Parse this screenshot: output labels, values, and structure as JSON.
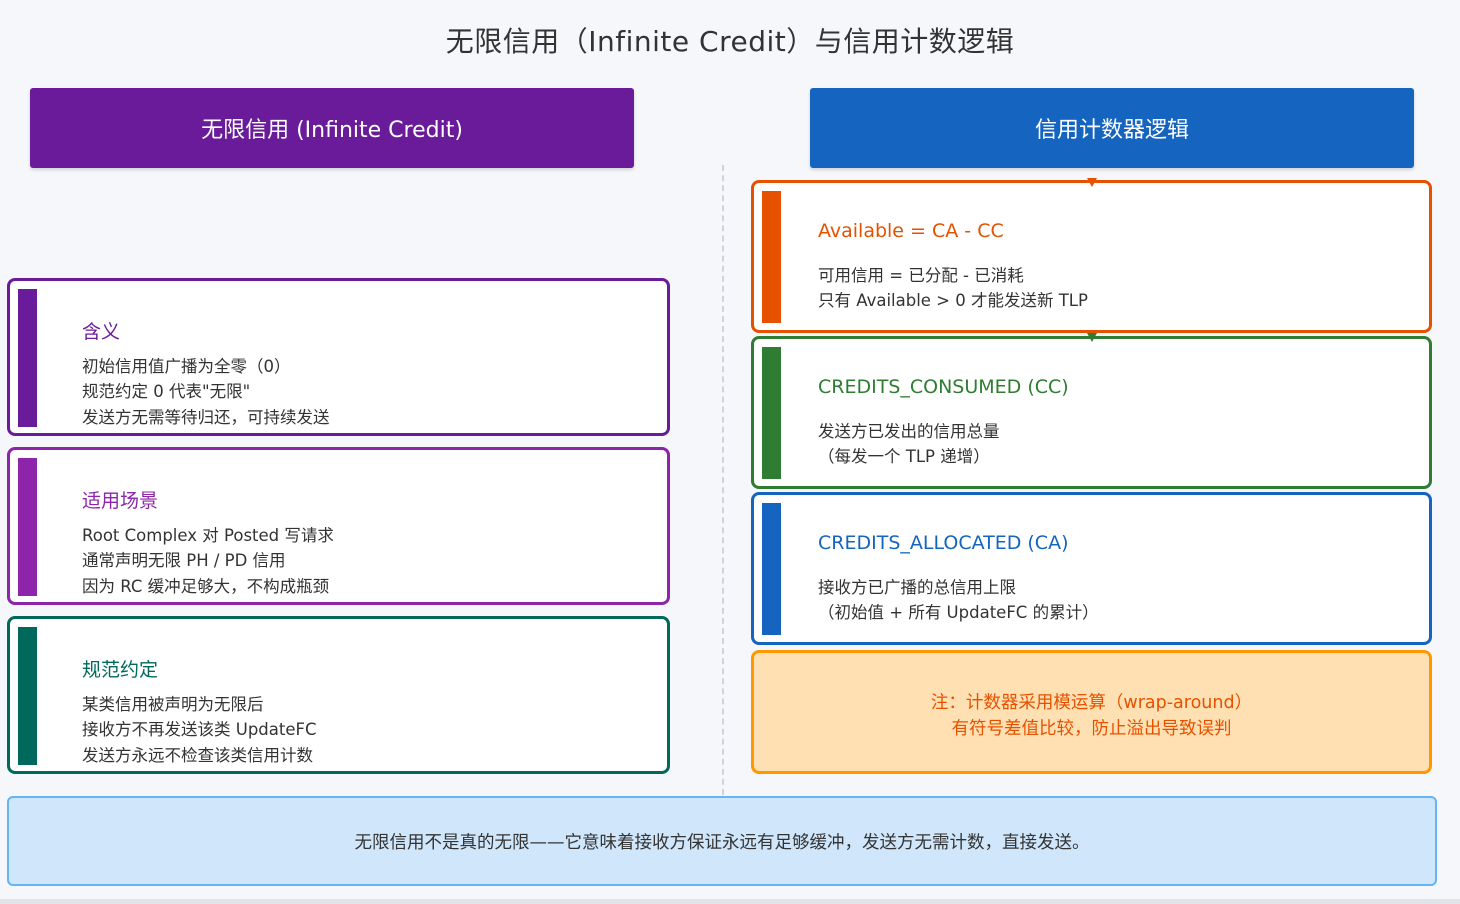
{
  "title": "无限信用（Infinite Credit）与信用计数逻辑",
  "left_header": "无限信用 (Infinite Credit)",
  "right_header": "信用计数器逻辑",
  "left_cards": [
    {
      "title": "含义",
      "lines": [
        "初始信用值广播为全零（0）",
        "规范约定 0 代表\"无限\"",
        "发送方无需等待归还，可持续发送"
      ]
    },
    {
      "title": "适用场景",
      "lines": [
        "Root Complex 对 Posted 写请求",
        "通常声明无限 PH / PD 信用",
        "因为 RC 缓冲足够大，不构成瓶颈"
      ]
    },
    {
      "title": "规范约定",
      "lines": [
        "某类信用被声明为无限后",
        "接收方不再发送该类 UpdateFC",
        "发送方永远不检查该类信用计数"
      ]
    }
  ],
  "right_cards": [
    {
      "title": "Available = CA - CC",
      "lines": [
        "可用信用 = 已分配 - 已消耗",
        "只有 Available > 0 才能发送新 TLP"
      ]
    },
    {
      "title": "CREDITS_CONSUMED (CC)",
      "lines": [
        "发送方已发出的信用总量",
        "（每发一个 TLP 递增）"
      ]
    },
    {
      "title": "CREDITS_ALLOCATED (CA)",
      "lines": [
        "接收方已广播的总信用上限",
        "（初始值 + 所有 UpdateFC 的累计）"
      ]
    }
  ],
  "note": {
    "line1": "注：计数器采用模运算（wrap-around）",
    "line2": "有符号差值比较，防止溢出导致误判"
  },
  "summary": "无限信用不是真的无限——它意味着接收方保证永远有足够缓冲，发送方无需计数，直接发送。",
  "colors": {
    "purple": "#6a1b9a",
    "magenta": "#8e24aa",
    "teal": "#00695c",
    "blue": "#1565c0",
    "orange": "#e65100",
    "green": "#2e7d32",
    "note_bg": "#ffe0b2",
    "summary_bg": "#cfe6fb"
  }
}
